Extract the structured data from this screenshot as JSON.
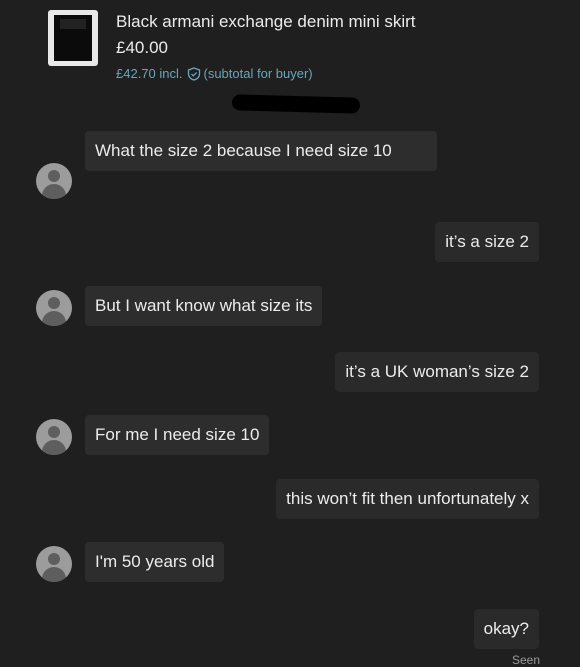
{
  "item": {
    "title": "Black armani exchange denim mini skirt",
    "price": "£40.00",
    "buyer_price": "£42.70 incl.",
    "buyer_note": "(subtotal for buyer)"
  },
  "messages": [
    {
      "from": "buyer",
      "text": "What the size 2 because I need size 10"
    },
    {
      "from": "seller",
      "text": "it’s a size 2"
    },
    {
      "from": "buyer",
      "text": "But I want know what  size its"
    },
    {
      "from": "seller",
      "text": "it’s a UK woman’s size 2"
    },
    {
      "from": "buyer",
      "text": "For me I need size 10"
    },
    {
      "from": "seller",
      "text": "this won’t fit then unfortunately x"
    },
    {
      "from": "buyer",
      "text": "I'm 50 years old"
    },
    {
      "from": "seller",
      "text": "okay?"
    }
  ],
  "status": {
    "seen": "Seen"
  },
  "colors": {
    "background": "#1f1f1f",
    "bubble": "#2d2d2d",
    "accent": "#6aa6ba"
  },
  "icons": [
    "item-thumbnail",
    "shield-check-icon",
    "avatar-placeholder-icon"
  ]
}
